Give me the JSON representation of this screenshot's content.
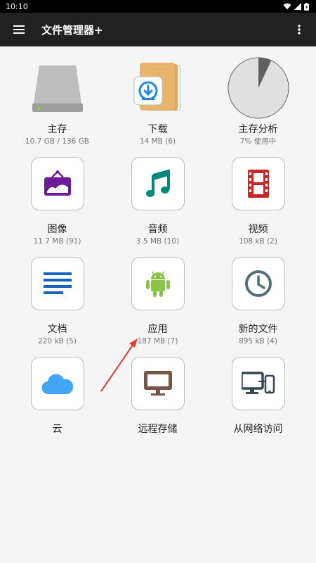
{
  "status_bar": {
    "time": "10:10"
  },
  "app_bar": {
    "title": "文件管理器+"
  },
  "tiles": [
    {
      "label": "主存",
      "sub": "10.7 GB / 136 GB",
      "icon": "hard-drive-icon"
    },
    {
      "label": "下载",
      "sub": "14 MB (6)",
      "icon": "download-folder-icon"
    },
    {
      "label": "主存分析",
      "sub": "7% 使用中",
      "icon": "pie-chart-icon",
      "used_fraction": 0.07
    },
    {
      "label": "图像",
      "sub": "11.7 MB (91)",
      "icon": "image-frame-icon"
    },
    {
      "label": "音频",
      "sub": "3.5 MB (10)",
      "icon": "music-note-icon"
    },
    {
      "label": "视频",
      "sub": "108 kB (2)",
      "icon": "film-strip-icon"
    },
    {
      "label": "文档",
      "sub": "220 kB (5)",
      "icon": "document-lines-icon"
    },
    {
      "label": "应用",
      "sub": "187 MB (7)",
      "icon": "android-icon"
    },
    {
      "label": "新的文件",
      "sub": "895 kB (4)",
      "icon": "clock-icon"
    },
    {
      "label": "云",
      "sub": "",
      "icon": "cloud-icon"
    },
    {
      "label": "远程存储",
      "sub": "",
      "icon": "monitor-icon"
    },
    {
      "label": "从网络访问",
      "sub": "",
      "icon": "network-devices-icon"
    }
  ],
  "colors": {
    "app_bar": "#212121",
    "image_icon": "#6a1b9a",
    "audio_icon": "#00897b",
    "video_icon": "#c62828",
    "document_icon": "#1565c0",
    "android_icon": "#8bc34a",
    "clock_icon": "#546e7a",
    "cloud_icon": "#42a5f5",
    "monitor_icon": "#795548",
    "network_icon": "#37474f",
    "annotation_arrow": "#e53935"
  }
}
